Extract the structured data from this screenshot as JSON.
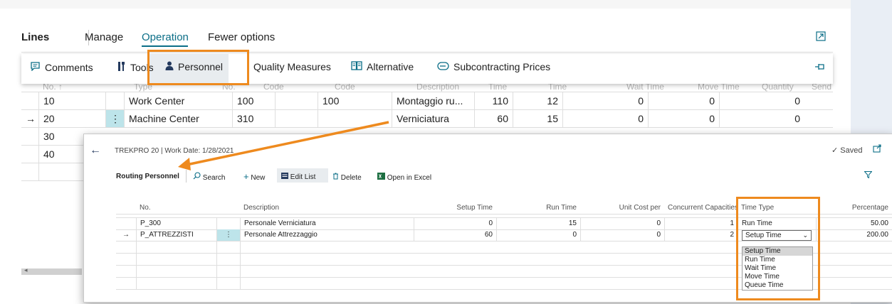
{
  "header": {
    "lines": "Lines",
    "manage": "Manage",
    "operation": "Operation",
    "fewer_options": "Fewer options"
  },
  "actions": {
    "comments": "Comments",
    "tools": "Tools",
    "personnel": "Personnel",
    "quality_measures": "Quality Measures",
    "alternative": "Alternative",
    "subcontracting_prices": "Subcontracting Prices"
  },
  "grid_ghost_headers": [
    "No. ↑",
    "Type",
    "No.",
    "Code",
    "Code",
    "Description",
    "Time",
    "Time",
    "Wait Time",
    "Move Time",
    "Quantity",
    "Send"
  ],
  "grid_rows": [
    {
      "arrow": "",
      "no": "10",
      "type": "Work Center",
      "wc_no": "100",
      "code1": "",
      "code2": "100",
      "description": "Montaggio ru...",
      "setup": "110",
      "run": "12",
      "wait": "0",
      "move": "0",
      "qty": "0"
    },
    {
      "arrow": "→",
      "no": "20",
      "type": "Machine Center",
      "wc_no": "310",
      "code1": "",
      "code2": "",
      "description": "Verniciatura",
      "setup": "60",
      "run": "15",
      "wait": "0",
      "move": "0",
      "qty": "0"
    },
    {
      "arrow": "",
      "no": "30",
      "type": "",
      "wc_no": "",
      "code1": "",
      "code2": "",
      "description": "",
      "setup": "",
      "run": "",
      "wait": "",
      "move": "",
      "qty": ""
    },
    {
      "arrow": "",
      "no": "40",
      "type": "",
      "wc_no": "",
      "code1": "",
      "code2": "",
      "description": "",
      "setup": "",
      "run": "",
      "wait": "",
      "move": "",
      "qty": ""
    }
  ],
  "popup": {
    "breadcrumb": "TREKPRO 20 | Work Date: 1/28/2021",
    "saved": "Saved",
    "title": "Routing Personnel",
    "search": "Search",
    "new": "New",
    "edit_list": "Edit List",
    "delete": "Delete",
    "open_excel": "Open in Excel",
    "columns": {
      "no": "No.",
      "description": "Description",
      "setup_time": "Setup Time",
      "run_time": "Run Time",
      "unit_cost": "Unit Cost per",
      "concurrent": "Concurrent Capacities",
      "time_type": "Time Type",
      "percentage": "Percentage"
    },
    "rows": [
      {
        "arrow": "",
        "no": "P_300",
        "description": "Personale Verniciatura",
        "setup": "0",
        "run": "15",
        "unit_cost": "0",
        "concurrent": "1",
        "time_type": "Run Time",
        "percentage": "50.00"
      },
      {
        "arrow": "→",
        "no": "P_ATTREZZISTI",
        "description": "Personale Attrezzaggio",
        "setup": "60",
        "run": "0",
        "unit_cost": "0",
        "concurrent": "2",
        "time_type": "Setup Time",
        "percentage": "200.00"
      }
    ],
    "time_type_options": [
      "Setup Time",
      "Run Time",
      "Wait Time",
      "Move Time",
      "Queue Time"
    ]
  },
  "colors": {
    "accent": "#0b6e87",
    "highlight": "#ee8a1e",
    "selected_row_marker": "#bde4ea"
  }
}
